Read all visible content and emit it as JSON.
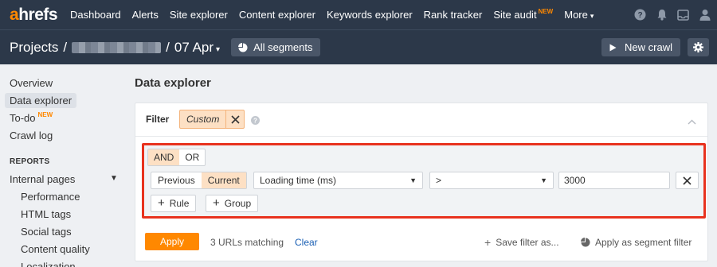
{
  "topnav": {
    "logo_a": "a",
    "logo_rest": "hrefs",
    "items": [
      {
        "label": "Dashboard"
      },
      {
        "label": "Alerts"
      },
      {
        "label": "Site explorer"
      },
      {
        "label": "Content explorer"
      },
      {
        "label": "Keywords explorer"
      },
      {
        "label": "Rank tracker"
      },
      {
        "label": "Site audit",
        "badge": "NEW"
      },
      {
        "label": "More"
      }
    ],
    "icons": [
      "help-icon",
      "bell-icon",
      "inbox-icon",
      "user-icon"
    ]
  },
  "subbar": {
    "projects": "Projects",
    "separator": "/",
    "date": "07 Apr",
    "segments_label": "All segments",
    "new_crawl_label": "New crawl"
  },
  "sidebar": {
    "items": [
      {
        "label": "Overview"
      },
      {
        "label": "Data explorer"
      },
      {
        "label": "To-do",
        "badge": "NEW"
      },
      {
        "label": "Crawl log"
      }
    ],
    "reports_heading": "REPORTS",
    "internal_pages": "Internal pages",
    "sub_items": [
      {
        "label": "Performance"
      },
      {
        "label": "HTML tags"
      },
      {
        "label": "Social tags"
      },
      {
        "label": "Content quality"
      },
      {
        "label": "Localization"
      }
    ]
  },
  "main": {
    "title": "Data explorer",
    "filter": {
      "label": "Filter",
      "chip_label": "Custom"
    },
    "builder": {
      "logic_and": "AND",
      "logic_or": "OR",
      "previous": "Previous",
      "current": "Current",
      "field": "Loading time (ms)",
      "operator": ">",
      "value": "3000",
      "rule_label": "Rule",
      "group_label": "Group"
    },
    "footer": {
      "apply_label": "Apply",
      "match_text": "3 URLs matching",
      "clear_label": "Clear",
      "save_filter_label": "Save filter as...",
      "segment_filter_label": "Apply as segment filter"
    }
  },
  "colors": {
    "nav_bg": "#2c3849",
    "accent": "#ff8800",
    "highlight_border": "#e8321e",
    "active_toggle": "#fde0c4",
    "link": "#1a5fb4"
  }
}
